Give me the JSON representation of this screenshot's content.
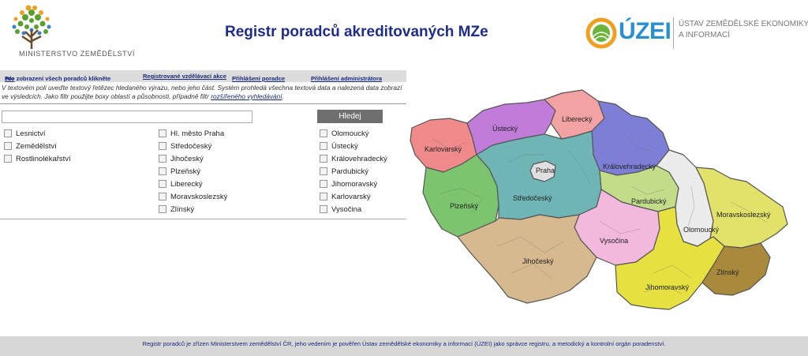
{
  "header": {
    "ministry_name": "MINISTERSTVO ZEMĚDĚLSTVÍ",
    "title": "Registr poradců akreditovaných MZe",
    "uzei_word": "ÚZEI",
    "uzei_full_line1": "ÚSTAV ZEMĚDĚLSKÉ EKONOMIKY",
    "uzei_full_line2": "A INFORMACÍ"
  },
  "nav": {
    "all_prefix": "Pro zobrazení všech poradců klikněte ",
    "all_link": "zde",
    "all_suffix": ".",
    "courses": "Registrované vzdělávací akce",
    "advisor_login": "Přihlášení poradce",
    "admin_login": "Přihlášení administrátora"
  },
  "intro": {
    "text": "V textovém poli uveďte textový řetězec hledaného výrazu, nebo jeho část. Systém prohledá všechna textová data a nalezená data zobrazí ve výsledcích. Jako filtr použijte boxy oblastí a působnosti, případně filtr ",
    "link": "rozšířeného vyhledávání",
    "end": "."
  },
  "search": {
    "value": "",
    "button": "Hledej"
  },
  "filters": {
    "areas": [
      "Lesnictví",
      "Zemědělství",
      "Rostlinolékařství"
    ],
    "regions_col1": [
      "Hl. město Praha",
      "Středočeský",
      "Jihočeský",
      "Plzeňský",
      "Liberecký",
      "Moravskoslezský",
      "Zlínský"
    ],
    "regions_col2": [
      "Olomoucký",
      "Ústecký",
      "Královehradecký",
      "Pardubický",
      "Jihomoravský",
      "Karlovarský",
      "Vysočina"
    ]
  },
  "map": {
    "labels": {
      "karlovarsky": "Karlovarský",
      "ustecky": "Ústecký",
      "liberecky": "Liberecký",
      "kralovehradecky": "Královehradecký",
      "praha": "Praha",
      "stredocesky": "Středočeský",
      "plzensky": "Plzeňský",
      "pardubicky": "Pardubický",
      "olomoucky": "Olomoucký",
      "moravskoslezsky": "Moravskoslezský",
      "vysocina": "Vysočina",
      "jihocesky": "Jihočeský",
      "jihomoravsky": "Jihomoravský",
      "zlinsky": "Zlínský"
    },
    "colors": {
      "karlovarsky": "#f08a8a",
      "ustecky": "#c07cd8",
      "liberecky": "#f2a2a2",
      "kralovehradecky": "#7d7fd6",
      "praha": "#e0e0e0",
      "stredocesky": "#6fb5b5",
      "plzensky": "#7cc56e",
      "pardubicky": "#c2dc8a",
      "olomoucky": "#ebebeb",
      "moravskoslezsky": "#e2e26a",
      "vysocina": "#f2b9dc",
      "jihocesky": "#d6b98e",
      "jihomoravsky": "#e6e040",
      "zlinsky": "#a98a3c"
    }
  },
  "footer": {
    "text": "Registr poradců je zřízen Ministerstvem zemědělství ČR, jeho vedením je pověřen Ústav zemědělské ekonomiky a informací (ÚZEI) jako správce registru, a metodický a kontrolní orgán poradenství."
  }
}
